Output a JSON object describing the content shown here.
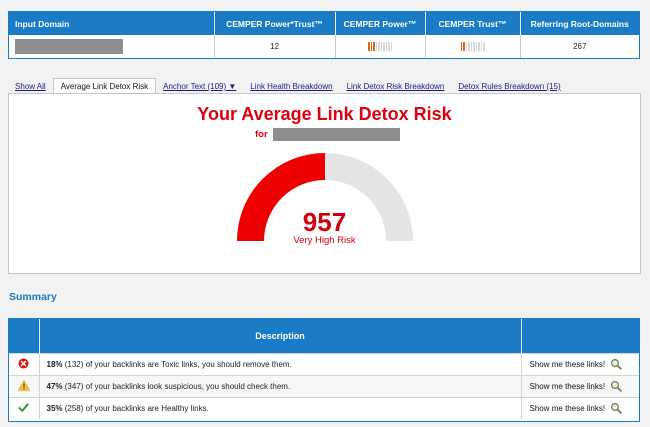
{
  "stats": {
    "headers": [
      "Input Domain",
      "CEMPER Power*Trust™",
      "CEMPER Power™",
      "CEMPER Trust™",
      "Referring Root-Domains"
    ],
    "power_trust": "12",
    "power_meter": {
      "filled": 3,
      "total": 10
    },
    "trust_meter": {
      "filled": 2,
      "total": 10
    },
    "referring_root_domains": "267"
  },
  "tabs": [
    {
      "label": "Show All",
      "active": false
    },
    {
      "label": "Average Link Detox Risk",
      "active": true
    },
    {
      "label": "Anchor Text (109) ▼",
      "active": false
    },
    {
      "label": "Link Health Breakdown",
      "active": false
    },
    {
      "label": "Link Detox Risk Breakdown",
      "active": false
    },
    {
      "label": "Detox Rules Breakdown (15)",
      "active": false
    }
  ],
  "risk": {
    "title": "Your Average Link Detox Risk",
    "for_label": "for",
    "score": "957",
    "score_label": "Very High Risk",
    "gauge_fraction": 0.5,
    "gauge_color": "#ee0000",
    "gauge_track_color": "#e4e4e4"
  },
  "summary": {
    "title": "Summary",
    "table_header": "Description",
    "rows": [
      {
        "icon": "error-circle-icon",
        "pct": "18%",
        "text": " (132) of your backlinks are Toxic links, you should remove them.",
        "link": "Show me these links!"
      },
      {
        "icon": "warning-triangle-icon",
        "pct": "47%",
        "text": " (347) of your backlinks look suspicious, you should check them.",
        "link": "Show me these links!"
      },
      {
        "icon": "checkmark-icon",
        "pct": "35%",
        "text": " (258) of your backlinks are Healthy links.",
        "link": "Show me these links!"
      }
    ]
  },
  "colors": {
    "accent": "#1a7bc6",
    "danger": "#e0000f"
  }
}
